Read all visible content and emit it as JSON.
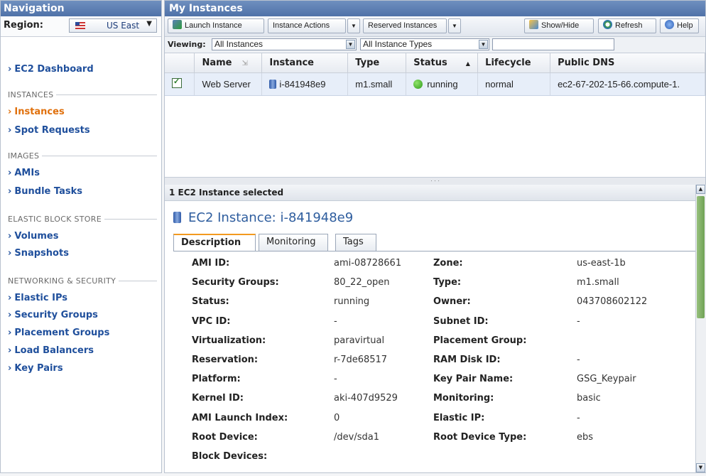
{
  "nav": {
    "title": "Navigation",
    "region_label": "Region:",
    "region_value": "US East",
    "dashboard": "EC2 Dashboard",
    "sections": [
      {
        "heading": "INSTANCES",
        "items": [
          "Instances",
          "Spot Requests"
        ]
      },
      {
        "heading": "IMAGES",
        "items": [
          "AMIs",
          "Bundle Tasks"
        ]
      },
      {
        "heading": "ELASTIC BLOCK STORE",
        "items": [
          "Volumes",
          "Snapshots"
        ]
      },
      {
        "heading": "NETWORKING & SECURITY",
        "items": [
          "Elastic IPs",
          "Security Groups",
          "Placement Groups",
          "Load Balancers",
          "Key Pairs"
        ]
      }
    ],
    "active_item": "Instances"
  },
  "main": {
    "title": "My Instances",
    "toolbar": {
      "launch": "Launch Instance",
      "actions": "Instance Actions",
      "reserved": "Reserved Instances",
      "showhide": "Show/Hide",
      "refresh": "Refresh",
      "help": "Help"
    },
    "filter": {
      "viewing_label": "Viewing:",
      "instances_filter": "All Instances",
      "types_filter": "All Instance Types",
      "search_value": ""
    },
    "columns": [
      "Name",
      "Instance",
      "Type",
      "Status",
      "Lifecycle",
      "Public DNS"
    ],
    "rows": [
      {
        "name": "Web Server",
        "instance": "i-841948e9",
        "type": "m1.small",
        "status": "running",
        "lifecycle": "normal",
        "dns": "ec2-67-202-15-66.compute-1."
      }
    ]
  },
  "detail": {
    "selected_text": "1 EC2 Instance selected",
    "heading": "EC2 Instance: i-841948e9",
    "tabs": [
      "Description",
      "Monitoring",
      "Tags"
    ],
    "fields": [
      {
        "k1": "AMI ID:",
        "v1": "ami-08728661",
        "k2": "Zone:",
        "v2": "us-east-1b"
      },
      {
        "k1": "Security Groups:",
        "v1": "80_22_open",
        "k2": "Type:",
        "v2": "m1.small"
      },
      {
        "k1": "Status:",
        "v1": "running",
        "k2": "Owner:",
        "v2": "043708602122"
      },
      {
        "k1": "VPC ID:",
        "v1": "-",
        "k2": "Subnet ID:",
        "v2": "-"
      },
      {
        "k1": "Virtualization:",
        "v1": "paravirtual",
        "k2": "Placement Group:",
        "v2": ""
      },
      {
        "k1": "Reservation:",
        "v1": "r-7de68517",
        "k2": "RAM Disk ID:",
        "v2": "-"
      },
      {
        "k1": "Platform:",
        "v1": "-",
        "k2": "Key Pair Name:",
        "v2": "GSG_Keypair"
      },
      {
        "k1": "Kernel ID:",
        "v1": "aki-407d9529",
        "k2": "Monitoring:",
        "v2": "basic"
      },
      {
        "k1": "AMI Launch Index:",
        "v1": "0",
        "k2": "Elastic IP:",
        "v2": "-"
      },
      {
        "k1": "Root Device:",
        "v1": "/dev/sda1",
        "k2": "Root Device Type:",
        "v2": "ebs"
      },
      {
        "k1": "Block Devices:",
        "v1": "",
        "k2": "",
        "v2": ""
      }
    ]
  }
}
